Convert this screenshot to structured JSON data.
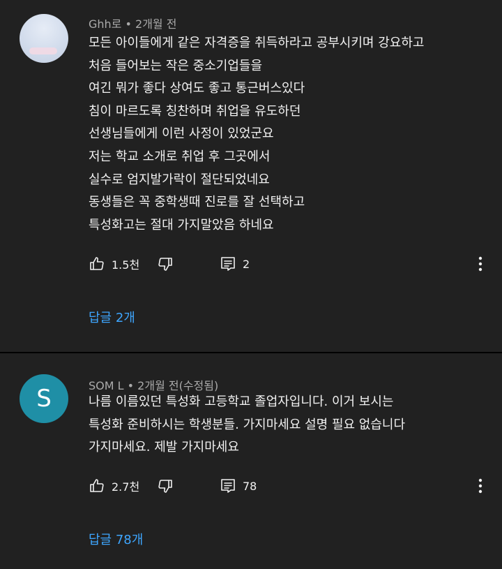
{
  "comments": [
    {
      "author": "Ghh로",
      "separator": " • ",
      "time": "2개월 전",
      "avatar_letter": "",
      "lines": [
        "모든 아이들에게 같은 자격증을 취득하라고 공부시키며 강요하고",
        "처음 들어보는 작은 중소기업들을",
        "여긴 뭐가 좋다 상여도 좋고 통근버스있다",
        "침이 마르도록 칭찬하며 취업을 유도하던",
        "선생님들에게 이런 사정이 있었군요",
        "저는 학교 소개로 취업 후 그곳에서",
        "실수로 엄지발가락이 절단되었네요",
        "동생들은 꼭 중학생때 진로를 잘 선택하고",
        "특성화고는 절대 가지말았음 하네요"
      ],
      "likes": "1.5천",
      "reply_count": "2",
      "replies_label": "답글 2개"
    },
    {
      "author": "SOM L",
      "separator": " • ",
      "time": "2개월 전(수정됨)",
      "avatar_letter": "S",
      "avatar_color": "#1f8fa6",
      "lines": [
        "나름 이름있던 특성화 고등학교 졸업자입니다. 이거 보시는",
        "특성화 준비하시는 학생분들. 가지마세요 설명 필요 없습니다",
        "가지마세요. 제발 가지마세요"
      ],
      "likes": "2.7천",
      "reply_count": "78",
      "replies_label": "답글 78개"
    }
  ],
  "icons": {
    "like": "thumbs-up-icon",
    "dislike": "thumbs-down-icon",
    "reply": "comment-icon",
    "more": "more-vertical-icon"
  },
  "colors": {
    "background": "#212121",
    "link": "#3ea6ff",
    "text": "#f1f1f1",
    "meta": "#aaaaaa"
  }
}
